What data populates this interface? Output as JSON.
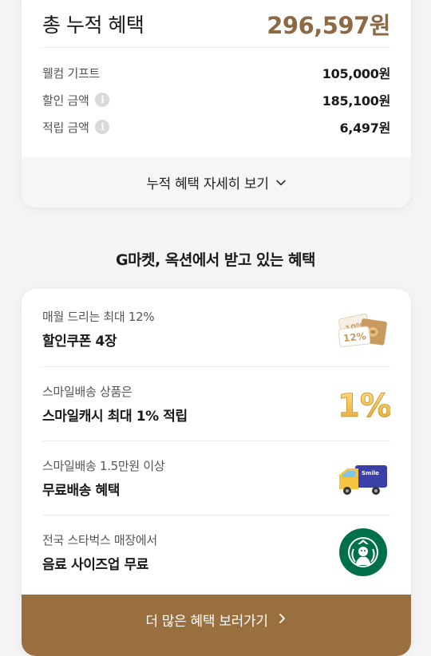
{
  "summary": {
    "total_label": "총 누적 혜택",
    "total_value": "296,597원",
    "rows": [
      {
        "label": "웰컴 기프트",
        "value": "105,000원",
        "info": false
      },
      {
        "label": "할인 금액",
        "value": "185,100원",
        "info": true
      },
      {
        "label": "적립 금액",
        "value": "6,497원",
        "info": true
      }
    ],
    "info_glyph": "i",
    "detail_toggle_label": "누적 혜택 자세히 보기"
  },
  "benefits": {
    "section_title": "G마켓, 옥션에서 받고 있는 혜택",
    "items": [
      {
        "sub": "매월 드리는 최대 12%",
        "main": "할인쿠폰 4장",
        "icon": "coupon-icon"
      },
      {
        "sub": "스마일배송 상품은",
        "main": "스마일캐시 최대 1% 적립",
        "icon": "one-percent-icon"
      },
      {
        "sub": "스마일배송 1.5만원 이상",
        "main": "무료배송 혜택",
        "icon": "delivery-truck-icon"
      },
      {
        "sub": "전국 스타벅스 매장에서",
        "main": "음료 사이즈업 무료",
        "icon": "starbucks-logo-icon"
      }
    ],
    "coupon_texts": [
      "10%",
      "12%"
    ],
    "one_percent_text": "1%",
    "truck_text": "Smile",
    "more_button_label": "더 많은 혜택 보러가기"
  },
  "colors": {
    "accent": "#8c6a44",
    "button_bg": "#9a6f3f",
    "starbucks_green": "#00704a"
  }
}
